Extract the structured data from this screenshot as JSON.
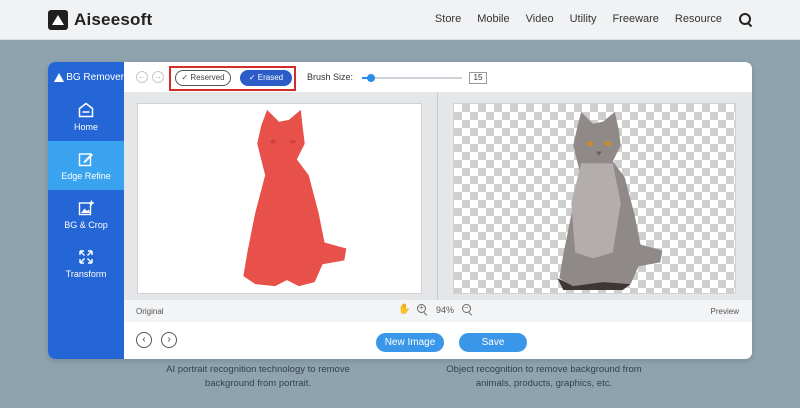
{
  "brand": {
    "name": "Aiseesoft"
  },
  "nav": {
    "items": [
      "Store",
      "Mobile",
      "Video",
      "Utility",
      "Freeware",
      "Resource"
    ]
  },
  "app": {
    "title": "BG Remover",
    "sidebar": [
      {
        "label": "Home",
        "icon": "home-icon"
      },
      {
        "label": "Edge Refine",
        "icon": "edit-icon",
        "active": true
      },
      {
        "label": "BG & Crop",
        "icon": "crop-image-icon"
      },
      {
        "label": "Transform",
        "icon": "transform-icon"
      }
    ],
    "toolbar": {
      "reserved_label": "Reserved",
      "erased_label": "Erased",
      "brush_label": "Brush Size:",
      "brush_value": "15",
      "brush_fraction": 0.09
    },
    "status": {
      "original_label": "Original",
      "zoom": "94%",
      "preview_label": "Preview"
    },
    "buttons": {
      "new_image": "New Image",
      "save": "Save"
    }
  },
  "captions": {
    "left": "AI portrait recognition technology to remove background from portrait.",
    "right": "Object recognition to remove background from animals, products, graphics, etc."
  },
  "colors": {
    "accent": "#2566d6",
    "active": "#3aa3f0",
    "highlight": "#d42b2b",
    "mask": "#e8504a"
  }
}
